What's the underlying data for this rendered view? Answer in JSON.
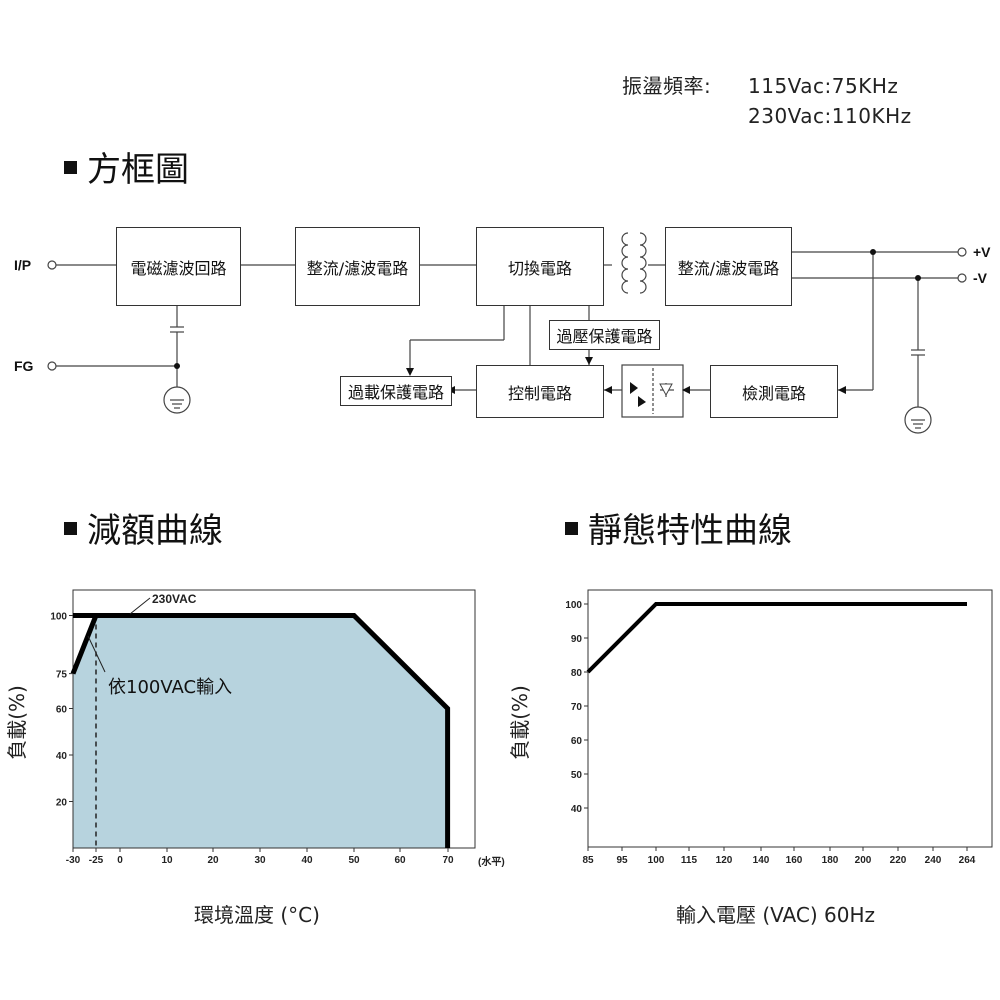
{
  "header": {
    "osc_label": "振盪頻率:",
    "osc_line1": "115Vac:75KHz",
    "osc_line2": "230Vac:110KHz"
  },
  "block_diagram": {
    "title": "方框圖",
    "labels": {
      "ip": "I/P",
      "fg": "FG",
      "plus_v": "+V",
      "minus_v": "-V"
    },
    "blocks": {
      "emi_filter": "電磁濾波回路",
      "rectifier_in": "整流/濾波電路",
      "switching": "切換電路",
      "rectifier_out": "整流/濾波電路",
      "ovp": "過壓保護電路",
      "olp": "過載保護電路",
      "control": "控制電路",
      "detection": "檢測電路"
    }
  },
  "derating": {
    "title": "減額曲線",
    "ylabel": "負載(%)",
    "xlabel": "環境溫度 (°C)",
    "annotation_230": "230VAC",
    "annotation_100": "依100VAC輸入",
    "horizontal_note": "(水平)",
    "x_ticks": [
      "-30",
      "-25",
      "0",
      "10",
      "20",
      "30",
      "40",
      "50",
      "60",
      "70"
    ],
    "y_ticks": [
      "100",
      "75",
      "60",
      "40",
      "20"
    ]
  },
  "static": {
    "title": "靜態特性曲線",
    "ylabel": "負載(%)",
    "xlabel": "輸入電壓 (VAC) 60Hz",
    "x_ticks": [
      "85",
      "95",
      "100",
      "115",
      "120",
      "140",
      "160",
      "180",
      "200",
      "220",
      "240",
      "264"
    ],
    "y_ticks": [
      "100",
      "90",
      "80",
      "70",
      "60",
      "50",
      "40"
    ]
  },
  "chart_data": [
    {
      "type": "area",
      "title": "減額曲線",
      "xlabel": "環境溫度 (°C)",
      "ylabel": "負載(%)",
      "series": [
        {
          "name": "230VAC",
          "x": [
            -30,
            50,
            70,
            70
          ],
          "y": [
            100,
            100,
            60,
            0
          ]
        },
        {
          "name": "依100VAC輸入",
          "x": [
            -30,
            -25,
            50,
            70,
            70
          ],
          "y": [
            75,
            100,
            100,
            60,
            0
          ]
        }
      ],
      "xlim": [
        -30,
        70
      ],
      "ylim": [
        0,
        100
      ],
      "grid": false
    },
    {
      "type": "line",
      "title": "靜態特性曲線",
      "xlabel": "輸入電壓 (VAC) 60Hz",
      "ylabel": "負載(%)",
      "series": [
        {
          "x": [
            "85",
            "100",
            "264"
          ],
          "y": [
            80,
            100,
            100
          ]
        }
      ],
      "ylim": [
        30,
        100
      ],
      "grid": false
    }
  ]
}
